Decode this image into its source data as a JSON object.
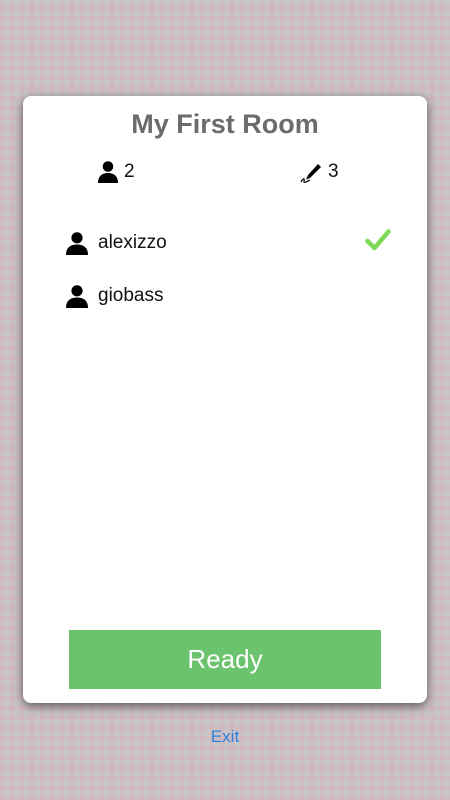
{
  "room": {
    "title": "My First Room",
    "player_count": "2",
    "round_count": "3"
  },
  "players": [
    {
      "name": "alexizzo",
      "ready": true
    },
    {
      "name": "giobass",
      "ready": false
    }
  ],
  "actions": {
    "ready_label": "Ready",
    "exit_label": "Exit"
  },
  "icons": {
    "players": "person-icon",
    "rounds": "pen-icon",
    "ready": "checkmark-icon"
  },
  "colors": {
    "ready_button": "#6cc36d",
    "checkmark": "#7ed957",
    "exit_link": "#2f7fe0",
    "title": "#6b6b6b"
  }
}
